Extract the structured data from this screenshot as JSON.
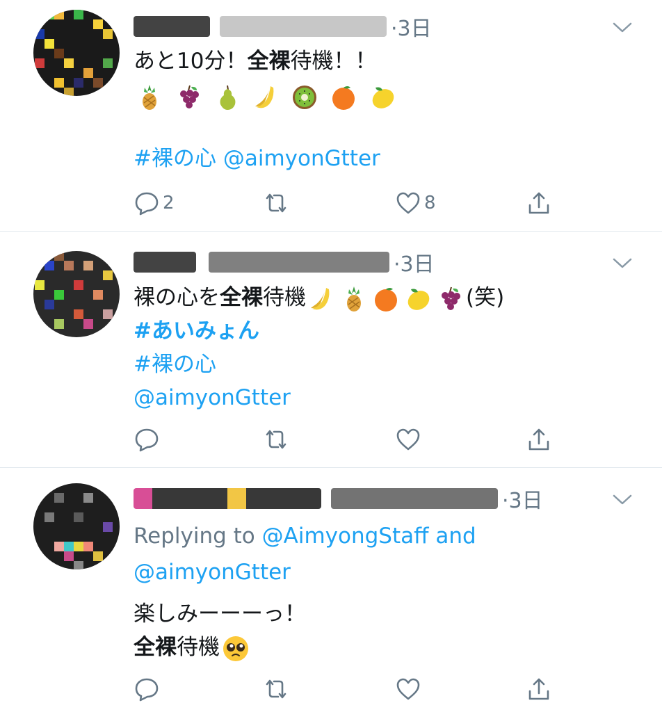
{
  "tweets": [
    {
      "timestamp": "·3日",
      "lines": [
        "あと10分！",
        "全裸",
        "待機！！"
      ],
      "emoji": [
        "pineapple",
        "grapes",
        "pear",
        "banana",
        "kiwi",
        "orange",
        "lemon"
      ],
      "hashtag": "#裸の心",
      "mention": "@aimyonGtter",
      "reply_count": "2",
      "like_count": "8"
    },
    {
      "timestamp": "·3日",
      "line1_pre": "裸の心を",
      "line1_bold": "全裸",
      "line1_post": "待機",
      "emoji": [
        "banana",
        "pineapple",
        "orange",
        "lemon",
        "grapes"
      ],
      "laugh": "(笑)",
      "hashtag1": "#あいみょん",
      "hashtag2": "#裸の心",
      "mention": "@aimyonGtter"
    },
    {
      "timestamp": "·3日",
      "replying_prefix": "Replying to ",
      "replying_to1": "@AimyongStaff and",
      "replying_to2": "@aimyonGtter",
      "text1": "楽しみーーーっ！",
      "text2_bold": "全裸",
      "text2_post": "待機",
      "emoji": "pleading-face"
    }
  ],
  "colors": {
    "accent": "#1da1f2",
    "muted": "#657786",
    "divider": "#e1e8ed",
    "text": "#14171a"
  }
}
